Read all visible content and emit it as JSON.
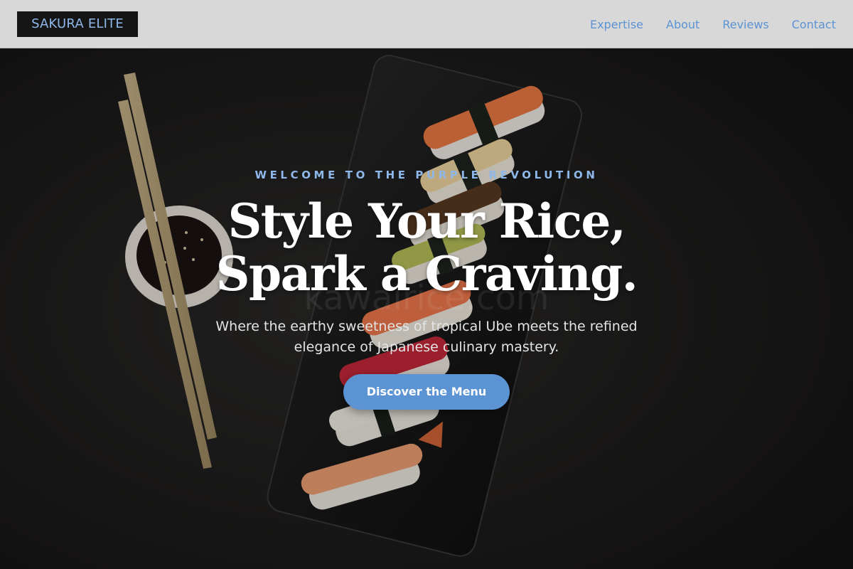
{
  "header": {
    "logo": "SAKURA ELITE",
    "nav": [
      {
        "label": "Expertise"
      },
      {
        "label": "About"
      },
      {
        "label": "Reviews"
      },
      {
        "label": "Contact"
      }
    ]
  },
  "hero": {
    "eyebrow": "WELCOME TO THE PURPLE REVOLUTION",
    "headline_line1": "Style Your Rice,",
    "headline_line2": "Spark a Craving.",
    "subtitle_line1": "Where the earthy sweetness of tropical Ube meets the refined",
    "subtitle_line2": "elegance of Japanese culinary mastery.",
    "cta_label": "Discover the Menu",
    "watermark": "kawairice.com"
  },
  "colors": {
    "accent": "#5b93d3",
    "logo_text": "#8fb8ea",
    "header_bg": "#d8d8d8",
    "hero_bg": "#1e1d1d"
  }
}
